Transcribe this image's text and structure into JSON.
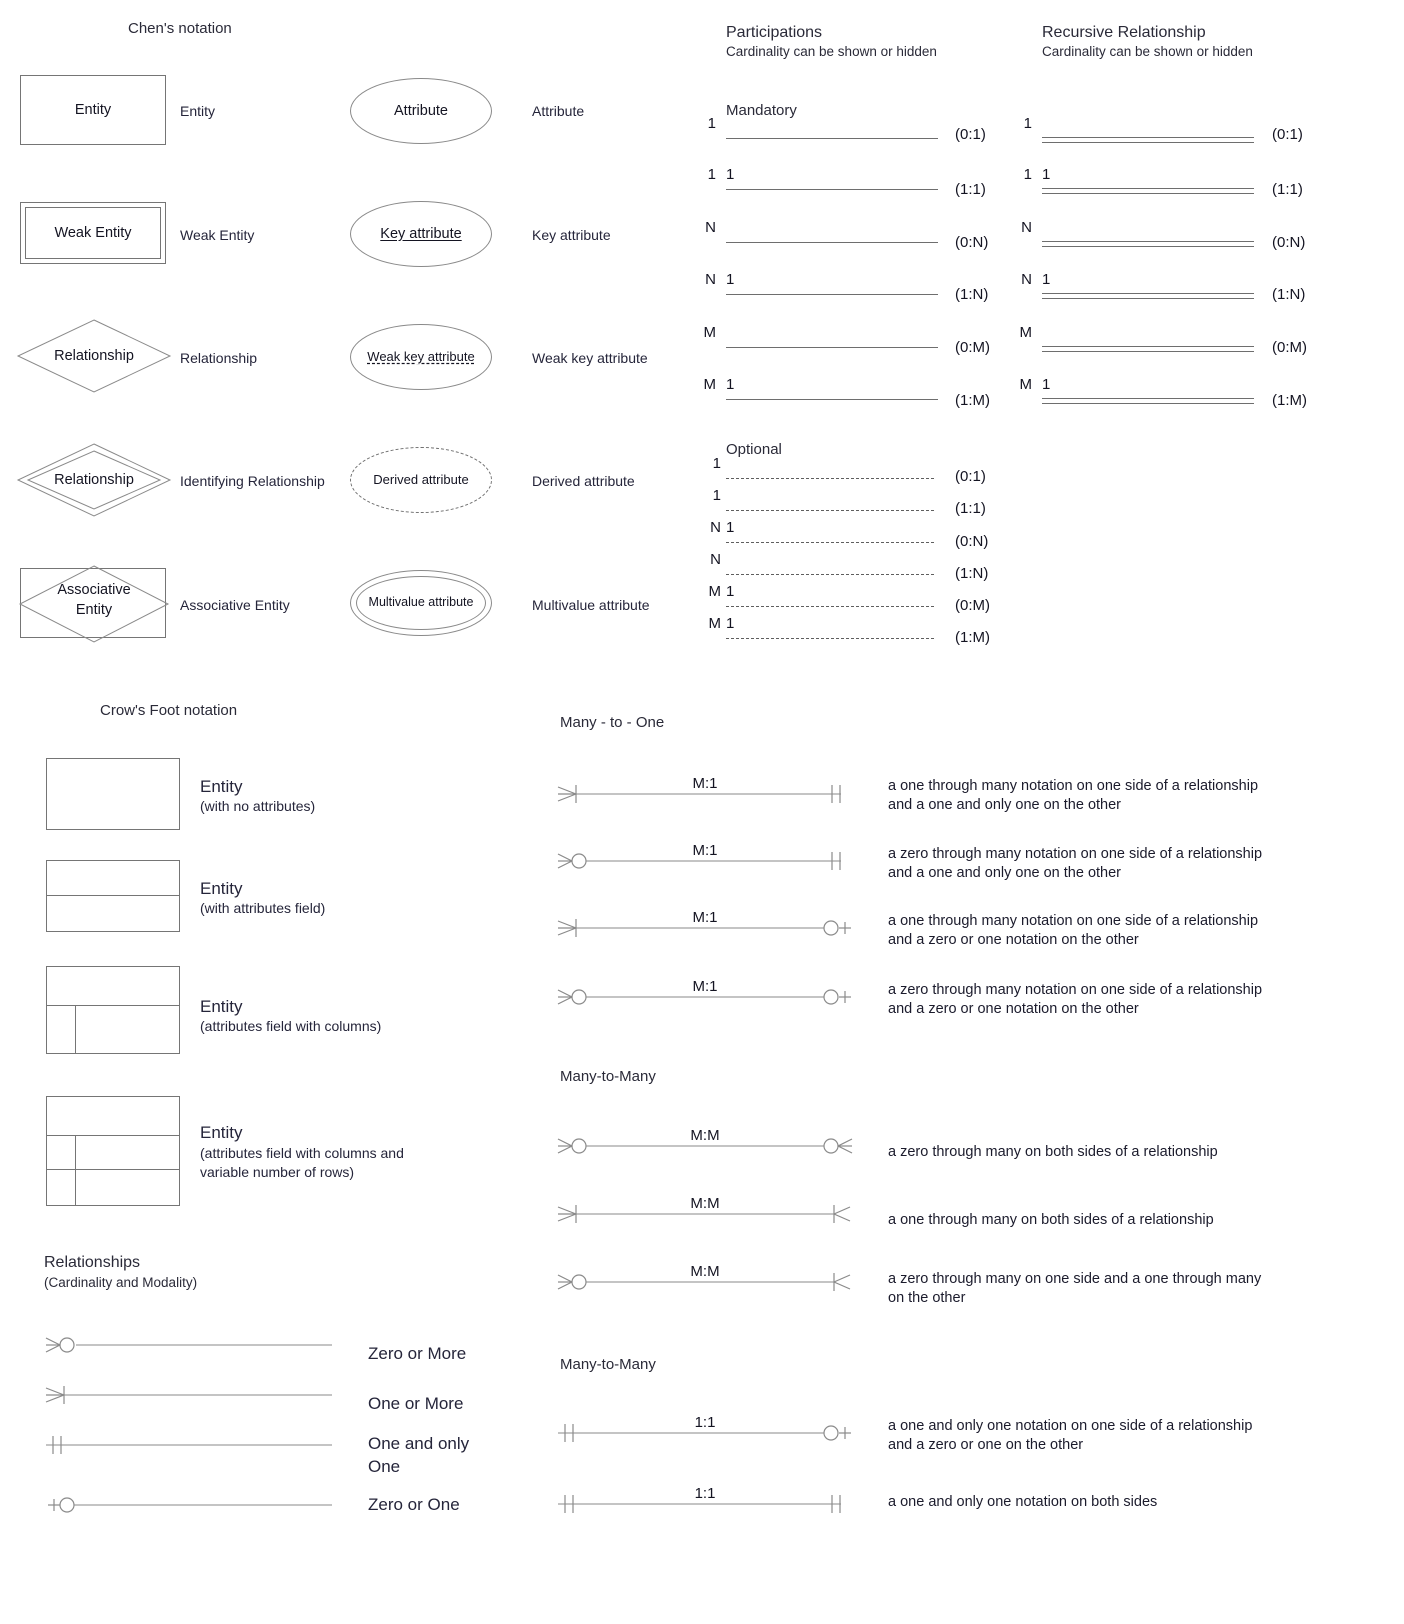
{
  "chen": {
    "title": "Chen's notation",
    "shapes": [
      {
        "shape_text": "Entity",
        "label": "Entity"
      },
      {
        "shape_text": "Weak Entity",
        "label": "Weak Entity"
      },
      {
        "shape_text": "Relationship",
        "label": "Relationship"
      },
      {
        "shape_text": "Relationship",
        "label": "Identifying Relationship"
      },
      {
        "shape_text": "Associative",
        "shape_text2": "Entity",
        "label": "Associative Entity"
      }
    ],
    "attributes": [
      {
        "shape_text": "Attribute",
        "label": "Attribute"
      },
      {
        "shape_text": "Key attribute",
        "label": "Key attribute"
      },
      {
        "shape_text": "Weak key attribute",
        "label": "Weak key attribute"
      },
      {
        "shape_text": "Derived attribute",
        "label": "Derived attribute"
      },
      {
        "shape_text": "Multivalue attribute",
        "label": "Multivalue attribute"
      }
    ]
  },
  "participations": {
    "title": "Participations",
    "subtitle": "Cardinality can be shown or hidden",
    "mandatory_label": "Mandatory",
    "optional_label": "Optional",
    "mandatory_rows": [
      {
        "left": "",
        "right": "1",
        "paren": "(0:1)"
      },
      {
        "left": "1",
        "right": "1",
        "paren": "(1:1)"
      },
      {
        "left": "",
        "right": "N",
        "paren": "(0:N)"
      },
      {
        "left": "1",
        "right": "N",
        "paren": "(1:N)"
      },
      {
        "left": "",
        "right": "M",
        "paren": "(0:M)"
      },
      {
        "left": "1",
        "right": "M",
        "paren": "(1:M)"
      }
    ],
    "optional_rows": [
      {
        "left": "",
        "right": "1",
        "paren": "(0:1)"
      },
      {
        "left": "",
        "right": "1",
        "paren": "(1:1)"
      },
      {
        "left": "1",
        "right": "N",
        "paren": "(0:N)"
      },
      {
        "left": "",
        "right": "N",
        "paren": "(1:N)"
      },
      {
        "left": "1",
        "right": "M",
        "paren": "(0:M)"
      },
      {
        "left": "1",
        "right": "M",
        "paren": "(1:M)"
      }
    ]
  },
  "recursive": {
    "title": "Recursive Relationship",
    "subtitle": "Cardinality can be shown or hidden",
    "rows": [
      {
        "left": "",
        "right": "1",
        "paren": "(0:1)"
      },
      {
        "left": "1",
        "right": "1",
        "paren": "(1:1)"
      },
      {
        "left": "",
        "right": "N",
        "paren": "(0:N)"
      },
      {
        "left": "1",
        "right": "N",
        "paren": "(1:N)"
      },
      {
        "left": "",
        "right": "M",
        "paren": "(0:M)"
      },
      {
        "left": "1",
        "right": "M",
        "paren": "(1:M)"
      }
    ]
  },
  "crowsfoot": {
    "title": "Crow's Foot notation",
    "entities": [
      {
        "name": "Entity",
        "desc": "(with no attributes)"
      },
      {
        "name": "Entity",
        "desc": "(with attributes field)"
      },
      {
        "name": "Entity",
        "desc": "(attributes field with columns)"
      },
      {
        "name": "Entity",
        "desc": "(attributes field with columns and",
        "desc2": "variable number of rows)"
      }
    ],
    "relationships_title": "Relationships",
    "relationships_sub": "(Cardinality and Modality)",
    "modality": [
      {
        "label": "Zero or More",
        "end": "crowfoot-circle"
      },
      {
        "label": "One or More",
        "end": "crowfoot-bar"
      },
      {
        "label": "One and only",
        "label2": "One",
        "end": "double-bar"
      },
      {
        "label": "Zero or One",
        "end": "bar-circle"
      }
    ]
  },
  "many_to_one": {
    "title": "Many - to - One",
    "rows": [
      {
        "cardinality": "M:1",
        "left_end": "crowfoot-bar",
        "right_end": "double-bar",
        "desc1": "a one through many notation on one side of a relationship",
        "desc2": "and a one and only one on the other"
      },
      {
        "cardinality": "M:1",
        "left_end": "crowfoot-circle",
        "right_end": "double-bar",
        "desc1": "a zero through many notation on one side of a relationship",
        "desc2": "and a one and only one on the other"
      },
      {
        "cardinality": "M:1",
        "left_end": "crowfoot-bar",
        "right_end": "circle-bar",
        "desc1": "a one through many notation on one side of a relationship",
        "desc2": "and a zero or one notation on the other"
      },
      {
        "cardinality": "M:1",
        "left_end": "crowfoot-circle",
        "right_end": "circle-bar",
        "desc1": "a zero through many notation on one side of a relationship",
        "desc2": "and a zero or one notation on the other"
      }
    ]
  },
  "many_to_many": {
    "title": "Many-to-Many",
    "rows": [
      {
        "cardinality": "M:M",
        "left_end": "crowfoot-circle",
        "right_end": "circle-crowfoot",
        "desc1": "a zero through many on both sides of a relationship",
        "desc2": ""
      },
      {
        "cardinality": "M:M",
        "left_end": "crowfoot-bar",
        "right_end": "bar-crowfoot",
        "desc1": "a one through many on both sides of a relationship",
        "desc2": ""
      },
      {
        "cardinality": "M:M",
        "left_end": "crowfoot-circle",
        "right_end": "bar-crowfoot",
        "desc1": "a zero through many on one side and a one through many",
        "desc2": "on the other"
      }
    ]
  },
  "one_to_one": {
    "title": "Many-to-Many",
    "rows": [
      {
        "cardinality": "1:1",
        "left_end": "double-bar",
        "right_end": "circle-bar",
        "desc1": "a one and only one notation on one side of a relationship",
        "desc2": "and a zero or one on the other"
      },
      {
        "cardinality": "1:1",
        "left_end": "double-bar",
        "right_end": "double-bar",
        "desc1": "a one and only one notation on both sides",
        "desc2": ""
      }
    ]
  },
  "colors": {
    "stroke": "#757575",
    "text": "#1a1a2e",
    "background": "#ffffff"
  }
}
